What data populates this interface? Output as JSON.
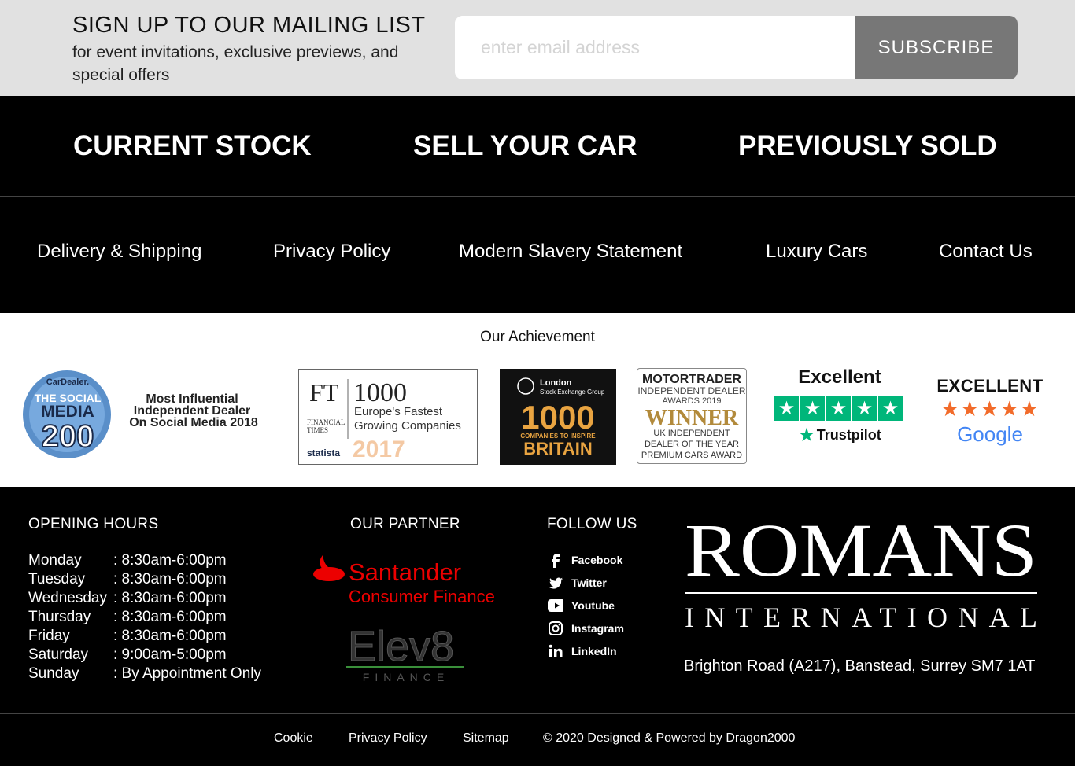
{
  "mailing": {
    "title": "SIGN UP TO OUR MAILING LIST",
    "subtitle": "for event invitations, exclusive previews, and special offers",
    "placeholder": "enter email address",
    "button": "SUBSCRIBE"
  },
  "main_nav": [
    "CURRENT STOCK",
    "SELL YOUR CAR",
    "PREVIOUSLY SOLD"
  ],
  "sub_nav": [
    "Delivery & Shipping",
    "Privacy Policy",
    "Modern Slavery Statement",
    "Luxury Cars",
    "Contact Us"
  ],
  "achievements": {
    "title": "Our Achievement",
    "social_media": {
      "brand": "CarDealer.",
      "line1": "THE SOCIAL",
      "line2": "MEDIA",
      "number": "200",
      "caption1": "Most Influential",
      "caption2": "Independent Dealer",
      "caption3": "On Social Media 2018"
    },
    "ft": {
      "ft": "FT",
      "number": "1000",
      "line1": "Europe's Fastest",
      "line2": "Growing Companies",
      "ft_name1": "FINANCIAL",
      "ft_name2": "TIMES",
      "statista": "statista",
      "year": "2017"
    },
    "lse": {
      "line1": "London",
      "line2": "Stock Exchange Group",
      "number": "1000",
      "line3": "COMPANIES TO INSPIRE",
      "line4": "BRITAIN"
    },
    "motortrader": {
      "line1": "MOTORTRADER",
      "line2": "INDEPENDENT DEALER",
      "line3": "AWARDS 2019",
      "line4": "WINNER",
      "line5": "UK INDEPENDENT",
      "line6": "DEALER OF THE YEAR",
      "line7": "PREMIUM CARS AWARD"
    },
    "trustpilot": {
      "rating": "Excellent",
      "brand": "Trustpilot",
      "stars": 5
    },
    "google": {
      "rating": "EXCELLENT",
      "brand": "Google",
      "stars": 5
    }
  },
  "hours": {
    "title": "OPENING HOURS",
    "rows": [
      {
        "day": "Monday",
        "time": ": 8:30am-6:00pm"
      },
      {
        "day": "Tuesday",
        "time": ": 8:30am-6:00pm"
      },
      {
        "day": "Wednesday",
        "time": ": 8:30am-6:00pm"
      },
      {
        "day": "Thursday",
        "time": ": 8:30am-6:00pm"
      },
      {
        "day": "Friday",
        "time": ": 8:30am-6:00pm"
      },
      {
        "day": "Saturday",
        "time": ": 9:00am-5:00pm"
      },
      {
        "day": "Sunday",
        "time": ": By Appointment Only"
      }
    ]
  },
  "partner": {
    "title": "OUR PARTNER",
    "santander": "Santander",
    "santander_sub": "Consumer Finance",
    "elev8": "Elev8",
    "elev8_sub": "FINANCE"
  },
  "follow": {
    "title": "FOLLOW US",
    "items": [
      "Facebook",
      "Twitter",
      "Youtube",
      "Instagram",
      "LinkedIn"
    ]
  },
  "brand": {
    "name": "ROMANS",
    "sub": "INTERNATIONAL"
  },
  "address": "Brighton Road (A217), Banstead, Surrey SM7 1AT",
  "bottom": {
    "cookie": "Cookie",
    "privacy": "Privacy Policy",
    "sitemap": "Sitemap",
    "copyright": "© 2020 Designed & Powered by Dragon2000"
  },
  "colors": {
    "trustpilot_green": "#00b67a",
    "google_star": "#f26b2a",
    "santander_red": "#ec0000",
    "elev8_green": "#3a8f3a",
    "lse_gold": "#e9a441",
    "motortrader_gold": "#b28a3b"
  }
}
